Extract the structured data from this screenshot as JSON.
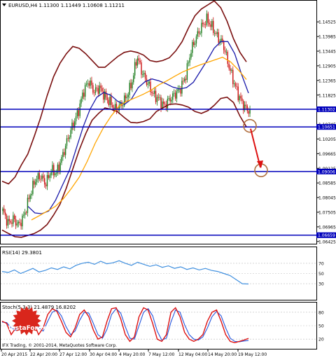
{
  "header": {
    "title": "EURUSD,H4  1.11300 1.11449 1.10608 1.11211",
    "rsi_label": "RSI(14) 29.3801",
    "stoch_label": "Stoch(5,3,3) 21.4879 16.8202",
    "copyright": "IFX Trading, © 2001-2014, MetaQuotes Software Corp.",
    "logo_text": "InstaForex"
  },
  "colors": {
    "price_bull": "#1a7a1a",
    "price_bear": "#cc1111",
    "bollinger": "#7a0f0f",
    "ma_fast": "#1a1aaa",
    "ma_slow": "#ffa500",
    "level_line": "#0000bb",
    "arrow": "#dd1111",
    "rsi_line": "#3f8fdf",
    "stoch_main": "#dd1111",
    "stoch_signal": "#2255dd",
    "logo_red": "#d9261c"
  },
  "chart_data": [
    {
      "type": "candlestick",
      "title": "EURUSD,H4",
      "ohlc_readout": [
        1.113,
        1.11449,
        1.10608,
        1.11211
      ],
      "xlabel": "",
      "ylabel": "",
      "ylim": [
        1.0642,
        1.1497
      ],
      "y_ticks": [
        "1.14525",
        "1.13985",
        "1.13445",
        "1.12905",
        "1.12365",
        "1.11825",
        "1.11285",
        "1.10745",
        "1.10205",
        "1.09665",
        "1.09125",
        "1.08585",
        "1.08045",
        "1.07505",
        "1.06965",
        "1.06425"
      ],
      "x_tick_labels": [
        "20 Apr 2015",
        "22 Apr 20:00",
        "27 Apr 12:00",
        "30 Apr 04:00",
        "4 May 20:00",
        "7 May 12:00",
        "12 May 04:00",
        "14 May 20:00",
        "19 May 12:00"
      ],
      "horizontal_levels": [
        {
          "value": 1.11302,
          "label": "1.11302"
        },
        {
          "value": 1.10651,
          "label": "1.10651"
        },
        {
          "value": 1.09006,
          "label": "1.09006"
        },
        {
          "value": 1.06659,
          "label": "1.06659"
        }
      ],
      "projection_arrow": {
        "from_value": 1.1069,
        "to_value": 1.0905
      },
      "close_path": [
        1.0755,
        1.071,
        1.0725,
        1.0702,
        1.074,
        1.081,
        1.0868,
        1.0885,
        1.0855,
        1.0905,
        1.0895,
        1.095,
        1.1015,
        1.107,
        1.1118,
        1.1195,
        1.1235,
        1.1195,
        1.121,
        1.1178,
        1.1155,
        1.113,
        1.1145,
        1.1175,
        1.1225,
        1.1325,
        1.1262,
        1.1225,
        1.1185,
        1.1168,
        1.1142,
        1.1165,
        1.1185,
        1.1205,
        1.125,
        1.1345,
        1.1395,
        1.1435,
        1.1462,
        1.1432,
        1.1395,
        1.1372,
        1.1295,
        1.123,
        1.1175,
        1.1138,
        1.1121
      ],
      "series_bb_upper": [
        1.0865,
        1.0855,
        1.088,
        1.0925,
        1.0965,
        1.103,
        1.11,
        1.118,
        1.125,
        1.13,
        1.1335,
        1.1362,
        1.1355,
        1.1335,
        1.131,
        1.1285,
        1.1285,
        1.1305,
        1.1325,
        1.134,
        1.1345,
        1.134,
        1.133,
        1.131,
        1.1305,
        1.131,
        1.132,
        1.1345,
        1.138,
        1.143,
        1.1475,
        1.15,
        1.1515,
        1.153,
        1.1505,
        1.1455,
        1.139,
        1.134,
        1.1305
      ],
      "series_bb_lower": [
        1.0685,
        1.0672,
        1.066,
        1.0658,
        1.0665,
        1.0672,
        1.0685,
        1.0705,
        1.074,
        1.078,
        1.084,
        1.091,
        1.098,
        1.104,
        1.109,
        1.1115,
        1.1135,
        1.113,
        1.112,
        1.11,
        1.1082,
        1.108,
        1.1085,
        1.1095,
        1.1122,
        1.1135,
        1.1148,
        1.115,
        1.1146,
        1.1138,
        1.1122,
        1.1115,
        1.1125,
        1.1145,
        1.117,
        1.1175,
        1.1155,
        1.1105,
        1.1065
      ],
      "series_ma_fast": [
        1.0772,
        1.0748,
        1.0745,
        1.0755,
        1.0795,
        1.085,
        1.0905,
        1.0985,
        1.1065,
        1.113,
        1.1175,
        1.1192,
        1.1182,
        1.116,
        1.1148,
        1.1168,
        1.121,
        1.1232,
        1.1242,
        1.1235,
        1.1225,
        1.1212,
        1.1205,
        1.121,
        1.123,
        1.127,
        1.131,
        1.1355,
        1.138,
        1.138,
        1.1335,
        1.1258,
        1.119
      ],
      "series_ma_slow": [
        1.0722,
        1.0738,
        1.0755,
        1.0772,
        1.08,
        1.0838,
        1.088,
        1.0938,
        1.1005,
        1.106,
        1.1105,
        1.1142,
        1.116,
        1.1172,
        1.1185,
        1.12,
        1.122,
        1.1235,
        1.1252,
        1.1268,
        1.128,
        1.1292,
        1.1302,
        1.1312,
        1.1322,
        1.1305,
        1.1275,
        1.124
      ]
    },
    {
      "type": "line",
      "title": "RSI(14)",
      "ylim": [
        0,
        100
      ],
      "y_ticks": [
        "70",
        "50",
        "30"
      ],
      "values": [
        54,
        52,
        57,
        50,
        55,
        60,
        53,
        56,
        61,
        58,
        63,
        59,
        66,
        70,
        72,
        68,
        74,
        69,
        71,
        75,
        70,
        66,
        72,
        68,
        64,
        67,
        62,
        65,
        60,
        63,
        58,
        61,
        57,
        60,
        56,
        54,
        50,
        46,
        38,
        30,
        29.4
      ]
    },
    {
      "type": "line",
      "title": "Stoch(5,3,3)",
      "ylim": [
        0,
        100
      ],
      "y_ticks": [
        "80",
        "50",
        "20"
      ],
      "series": [
        {
          "values": [
            60,
            55,
            30,
            45,
            70,
            85,
            80,
            55,
            30,
            45,
            75,
            88,
            82,
            60,
            35,
            25,
            45,
            75,
            85,
            70,
            40,
            20,
            25,
            60,
            88,
            90,
            65,
            30,
            15,
            25,
            70,
            90,
            85,
            55,
            20,
            15,
            30,
            80,
            90,
            70,
            35,
            20,
            15,
            20,
            30,
            60,
            80,
            85,
            60,
            30,
            15,
            12,
            15,
            18,
            21.5
          ]
        },
        {
          "values": [
            58,
            57,
            45,
            40,
            55,
            75,
            82,
            70,
            45,
            38,
            60,
            80,
            85,
            72,
            48,
            30,
            38,
            62,
            80,
            78,
            55,
            30,
            22,
            42,
            75,
            88,
            78,
            48,
            22,
            20,
            50,
            80,
            88,
            72,
            38,
            18,
            22,
            58,
            85,
            80,
            52,
            30,
            20,
            18,
            25,
            45,
            70,
            82,
            72,
            45,
            22,
            15,
            14,
            16,
            16.8
          ]
        }
      ]
    }
  ]
}
